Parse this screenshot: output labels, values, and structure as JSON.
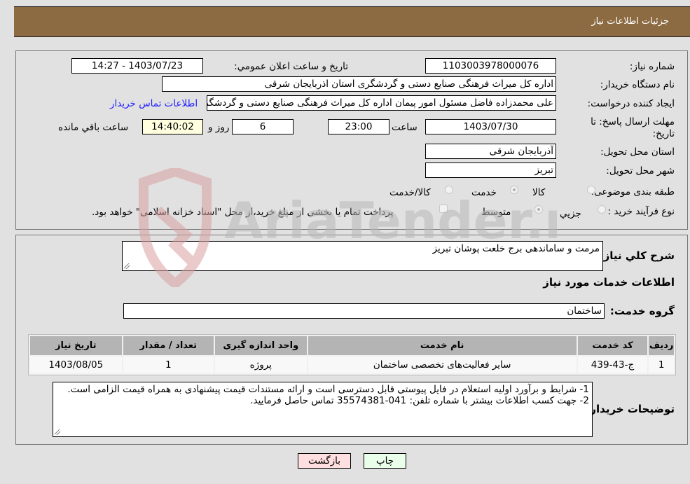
{
  "header": {
    "title": "جزئیات اطلاعات نیاز"
  },
  "details": {
    "need_number_label": "شماره نیاز:",
    "need_number": "1103003978000076",
    "announce_label": "تاریخ و ساعت اعلان عمومي:",
    "announce_value": "1403/07/23 - 14:27",
    "buyer_org_label": "نام دستگاه خريدار:",
    "buyer_org": "اداره کل میراث فرهنگی  صنایع دستی و گردشگری استان اذربایجان شرقی",
    "creator_label": "ایجاد کننده درخواست:",
    "creator": "علی محمدزاده فاضل مسئول امور پیمان اداره کل میراث فرهنگی  صنایع دستی و گردشگری",
    "contact_link": "اطلاعات تماس خریدار",
    "deadline_label": "مهلت ارسال پاسخ: تا تاریخ:",
    "deadline_date": "1403/07/30",
    "time_label": "ساعت",
    "deadline_time": "23:00",
    "days_value": "6",
    "days_label": "روز و",
    "remaining_time": "14:40:02",
    "remaining_label": "ساعت باقي مانده",
    "province_label": "استان محل تحویل:",
    "province": "آذربایجان شرقی",
    "city_label": "شهر محل تحویل:",
    "city": "تبریز",
    "category_label": "طبقه بندی موضوعی:",
    "category_options": [
      {
        "label": "کالا",
        "checked": false
      },
      {
        "label": "خدمت",
        "checked": true
      },
      {
        "label": "کالا/خدمت",
        "checked": false
      }
    ],
    "process_label": "نوع فرآیند خرید :",
    "process_options": [
      {
        "label": "جزيي",
        "checked": false
      },
      {
        "label": "متوسط",
        "checked": true
      }
    ],
    "treasury_checkbox_label": "پرداخت تمام یا بخشی از مبلغ خرید،از محل \"اسناد خزانه اسلامی\" خواهد بود.",
    "treasury_checked": false
  },
  "summary": {
    "description_label": "شرح کلي نياز:",
    "description": "مرمت و ساماندهی برج خلعت پوشان تبریز",
    "services_heading": "اطلاعات خدمات مورد نیاز",
    "service_group_label": "گروه خدمت:",
    "service_group": "ساختمان"
  },
  "table": {
    "headers": [
      "ردیف",
      "کد خدمت",
      "نام خدمت",
      "واحد اندازه گیری",
      "تعداد / مقدار",
      "تاریخ نیاز"
    ],
    "rows": [
      [
        "1",
        "ج-43-439",
        "سایر فعالیت‌های تخصصی ساختمان",
        "پروژه",
        "1",
        "1403/08/05"
      ]
    ]
  },
  "buyer_notes": {
    "label": "توضیحات خریدار:",
    "line1": "1- شرایط و برآورد اولیه استعلام در فایل پیوستی قابل دسترسی است و ارائه مستندات قیمت پیشنهادی به همراه قیمت الزامی است.",
    "line2": "2- جهت کسب اطلاعات بیشتر  با شماره تلفن: 041-35574381  تماس حاصل فرمایید."
  },
  "buttons": {
    "print": "چاپ",
    "back": "بازگشت"
  },
  "watermark": {
    "text": "AriaTender.neT"
  }
}
